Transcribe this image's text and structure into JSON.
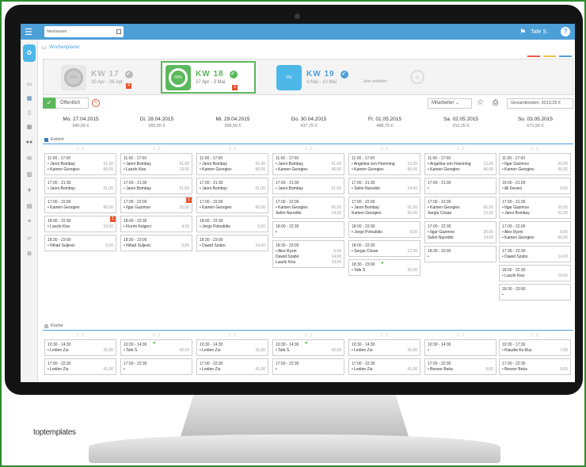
{
  "topbar": {
    "location": "Neuhausen",
    "user": "Tafe S.",
    "help": "?"
  },
  "header": {
    "title": "Wochenplaner"
  },
  "weeks": [
    {
      "label": "KW 17",
      "dates": "20 Apr - 26 Apr",
      "percent": "60%",
      "badge": "4"
    },
    {
      "label": "KW 18",
      "dates": "27 Apr - 3 Mai",
      "percent": "60%",
      "badge": "3"
    },
    {
      "label": "KW 19",
      "dates": "4 Mai - 10 Mai",
      "percent": "0%"
    }
  ],
  "create_label": "Jetzt erstellen",
  "toolbar": {
    "public": "Öffentlich",
    "employee": "Mitarbeiter",
    "total_cost": "Gesamtkosten: 3013,25 €"
  },
  "days": [
    {
      "date": "Mo. 27.04.2015",
      "cost": "340,00 €"
    },
    {
      "date": "Di. 28.04.2015",
      "cost": "365,50 €"
    },
    {
      "date": "Mi. 29.04.2015",
      "cost": "399,50 €"
    },
    {
      "date": "Do. 30.04.2015",
      "cost": "437,75 €"
    },
    {
      "date": "Fr. 01.05.2015",
      "cost": "488,75 €"
    },
    {
      "date": "Sa. 02.05.2015",
      "cost": "310,25 €"
    },
    {
      "date": "So. 03.05.2015",
      "cost": "671,50 €"
    }
  ],
  "sections": [
    {
      "name": "Estrich",
      "color": "#3a7bb5"
    },
    {
      "name": "Küche",
      "color": "#aaaaaa"
    }
  ],
  "estrich": [
    [
      {
        "time": "11:00 - 17:00",
        "rows": [
          [
            "• Janni Bombay",
            "51,00"
          ],
          [
            "• Kamen Georgiev",
            "66,00"
          ]
        ]
      },
      {
        "time": "17:00 - 21:30",
        "rows": [
          [
            "• Janni Bombay",
            "51,00"
          ]
        ]
      },
      {
        "time": "17:00 - 22:00",
        "rows": [
          [
            "• Kamen Georgiev",
            "66,00"
          ]
        ]
      },
      {
        "time": "18:00 - 22:30",
        "rows": [
          [
            "• Laszlo Kiss",
            "19,00"
          ]
        ],
        "badge": "1"
      },
      {
        "time": "18:30 - 23:00",
        "rows": [
          [
            "• Nihad Suljevic",
            "9,00"
          ]
        ]
      }
    ],
    [
      {
        "time": "11:00 - 17:00",
        "rows": [
          [
            "• Janni Bombay",
            "51,00"
          ],
          [
            "• Laszlo Kiss",
            "19,00"
          ]
        ]
      },
      {
        "time": "17:00 - 21:30",
        "rows": [
          [
            "• Janni Bombay",
            "51,00"
          ]
        ]
      },
      {
        "time": "17:00 - 22:00",
        "rows": [
          [
            "• Ilgar Gazimov",
            "20,00"
          ]
        ],
        "badge": "1"
      },
      {
        "time": "18:00 - 22:30",
        "rows": [
          [
            "• Florim Kolgeci",
            "4,00"
          ]
        ]
      },
      {
        "time": "18:30 - 23:00",
        "rows": [
          [
            "• Nihad Suljevic",
            "9,00"
          ]
        ]
      }
    ],
    [
      {
        "time": "11:00 - 17:00",
        "rows": [
          [
            "• Janni Bombay",
            "51,00"
          ],
          [
            "• Kamen Georgiev",
            "66,00"
          ]
        ]
      },
      {
        "time": "17:00 - 21:30",
        "rows": [
          [
            "• Janni Bombay",
            "51,00"
          ]
        ]
      },
      {
        "time": "17:00 - 22:00",
        "rows": [
          [
            "• Kamen Georgiev",
            "66,00"
          ]
        ]
      },
      {
        "time": "18:00 - 22:30",
        "rows": [
          [
            "• Jorgo Potoulidis",
            "9,00"
          ]
        ]
      },
      {
        "time": "18:30 - 23:00",
        "rows": [
          [
            "• Dawid Szabo",
            "14,00"
          ]
        ]
      }
    ],
    [
      {
        "time": "11:00 - 17:00",
        "rows": [
          [
            "• Janni Bombay",
            "51,00"
          ],
          [
            "• Kamen Georgiev",
            "66,00"
          ]
        ]
      },
      {
        "time": "17:00 - 21:30",
        "rows": [
          [
            "• Janni Bombay",
            "51,00"
          ]
        ]
      },
      {
        "time": "17:00 - 22:00",
        "rows": [
          [
            "• Kamen Georgiev",
            "66,00"
          ],
          [
            "Selim Nuredini",
            "14,00"
          ]
        ]
      },
      {
        "time": "18:00 - 22:30",
        "rows": [
          [
            "•",
            ""
          ]
        ]
      },
      {
        "time": "18:30 - 23:00",
        "rows": [
          [
            "• Alex Ryzni",
            "9,00"
          ],
          [
            "Dawid Szabo",
            "14,00"
          ],
          [
            "Laszlo Kiss",
            "19,00"
          ]
        ]
      }
    ],
    [
      {
        "time": "11:00 - 17:00",
        "rows": [
          [
            "• Angelina von Hoenning",
            "12,00"
          ],
          [
            "• Kamen Georgiev",
            "66,00"
          ]
        ]
      },
      {
        "time": "17:00 - 21:30",
        "rows": [
          [
            "• Selim Nuredini",
            "14,00"
          ]
        ]
      },
      {
        "time": "17:00 - 22:00",
        "rows": [
          [
            "• Janni Bombay",
            "51,00"
          ],
          [
            "Kamen Georgiev",
            "66,00"
          ]
        ]
      },
      {
        "time": "18:00 - 22:30",
        "rows": [
          [
            "• Jorgo Potoulidis",
            "9,00"
          ]
        ]
      },
      {
        "time": "18:00 - 22:30",
        "rows": [
          [
            "• Sergiu Crisan",
            "12,00"
          ]
        ]
      },
      {
        "time": "18:30 - 23:00",
        "rows": [
          [
            "• Tafe S.",
            "42,00"
          ]
        ],
        "person": true
      }
    ],
    [
      {
        "time": "11:00 - 17:00",
        "rows": [
          [
            "• Angelina von Hoenning",
            "12,00"
          ],
          [
            "• Kamen Georgiev",
            "66,00"
          ]
        ]
      },
      {
        "time": "17:00 - 21:30",
        "rows": [
          [
            "•",
            ""
          ]
        ]
      },
      {
        "time": "17:00 - 22:00",
        "rows": [
          [
            "• Kamen Georgiev",
            "66,00"
          ],
          [
            "Sergiu Crisan",
            "12,00"
          ]
        ]
      },
      {
        "time": "17:00 - 22:30",
        "rows": [
          [
            "• Ilgar Gazimov",
            "20,00"
          ],
          [
            "Selim Nuredini",
            "14,00"
          ]
        ]
      },
      {
        "time": "18:30 - 23:00",
        "rows": [
          [
            "•",
            ""
          ]
        ]
      }
    ],
    [
      {
        "time": "11:00 - 17:00",
        "rows": [
          [
            "• Ilgar Gazimov",
            "20,00"
          ],
          [
            "• Kamen Georgiev",
            "66,00"
          ]
        ]
      },
      {
        "time": "15:00 - 21:00",
        "rows": [
          [
            "• Ali Deveci",
            "9,00"
          ]
        ]
      },
      {
        "time": "17:00 - 21:30",
        "rows": [
          [
            "• Ilgar Gazimov",
            "20,50"
          ],
          [
            "• Janni Bombay",
            "51,00"
          ]
        ]
      },
      {
        "time": "17:00 - 22:00",
        "rows": [
          [
            "• Alex Ryzni",
            "9,00"
          ],
          [
            "• Kamen Georgiev",
            "66,00"
          ]
        ]
      },
      {
        "time": "17:30 - 22:30",
        "rows": [
          [
            "• Dawid Szabo",
            "14,00"
          ]
        ]
      },
      {
        "time": "18:00 - 22:30",
        "rows": [
          [
            "• Laszlo Kiss",
            "19,00"
          ]
        ]
      },
      {
        "time": "18:30 - 23:00",
        "rows": [
          [
            "•",
            ""
          ]
        ]
      }
    ]
  ],
  "kueche": [
    [
      {
        "time": "10:30 - 14:30",
        "rows": [
          [
            "• Ledion Ziu",
            "41,00"
          ]
        ]
      },
      {
        "time": "17:00 - 22:30",
        "rows": [
          [
            "• Ledion Ziu",
            "41,00"
          ]
        ]
      }
    ],
    [
      {
        "time": "10:30 - 14:30",
        "rows": [
          [
            "• Tafe S.",
            "42,00"
          ]
        ],
        "person": true
      },
      {
        "time": "17:00 - 22:30",
        "rows": [
          [
            "•",
            ""
          ]
        ]
      }
    ],
    [
      {
        "time": "10:30 - 14:30",
        "rows": [
          [
            "• Ledion Ziu",
            "41,00"
          ]
        ]
      },
      {
        "time": "17:00 - 22:30",
        "rows": [
          [
            "• Ledion Ziu",
            "41,00"
          ]
        ]
      }
    ],
    [
      {
        "time": "10:30 - 14:30",
        "rows": [
          [
            "• Tafe S.",
            "42,00"
          ]
        ],
        "person": true
      },
      {
        "time": "17:00 - 22:30",
        "rows": [
          [
            "•",
            ""
          ]
        ]
      }
    ],
    [
      {
        "time": "10:30 - 14:30",
        "rows": [
          [
            "• Ledion Ziu",
            "41,00"
          ]
        ]
      },
      {
        "time": "17:00 - 22:30",
        "rows": [
          [
            "• Ledion Ziu",
            "41,00"
          ]
        ]
      }
    ],
    [
      {
        "time": "10:30 - 14:30",
        "rows": [
          [
            "•",
            ""
          ]
        ]
      },
      {
        "time": "17:00 - 22:30",
        "rows": [
          [
            "• Besnor Beka",
            "9,00"
          ]
        ]
      }
    ],
    [
      {
        "time": "10:30 - 17:30",
        "rows": [
          [
            "• Klaudia Ko-Bus",
            "7,00"
          ]
        ]
      },
      {
        "time": "17:00 - 22:30",
        "rows": [
          [
            "• Besnor Beka",
            "9,00"
          ]
        ]
      }
    ]
  ],
  "credit": "toptemplates"
}
